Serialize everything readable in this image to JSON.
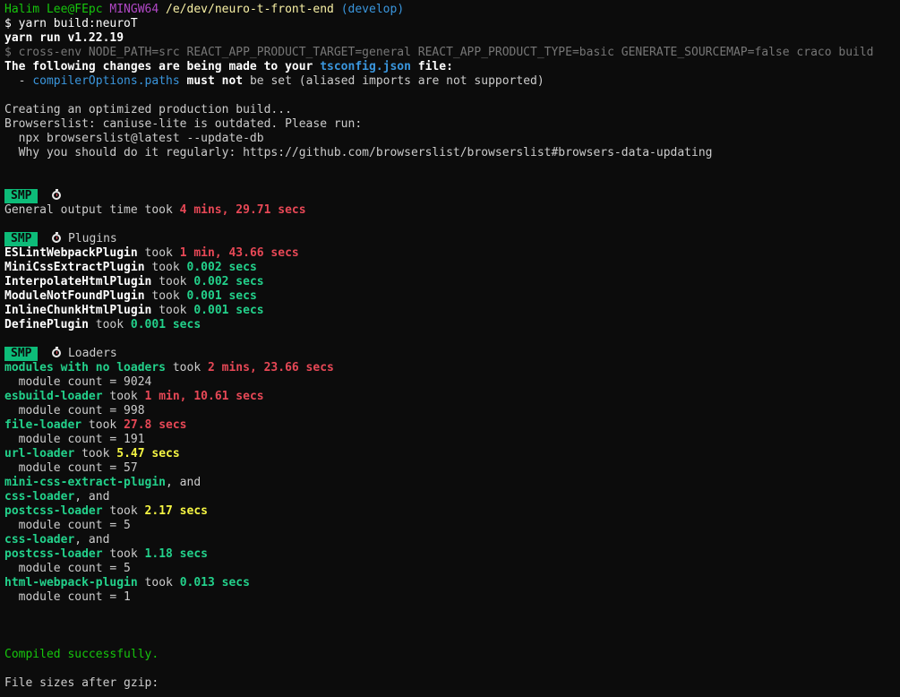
{
  "prompt": {
    "user": "Halim Lee@FEpc",
    "system": "MINGW64",
    "path": "/e/dev/neuro-t-front-end",
    "branch": "(develop)"
  },
  "command": "$ yarn build:neuroT",
  "yarn_version": "yarn run v1.22.19",
  "cross_env_cmd": "$ cross-env NODE_PATH=src REACT_APP_PRODUCT_TARGET=general REACT_APP_PRODUCT_TYPE=basic GENERATE_SOURCEMAP=false craco build",
  "tsconfig": {
    "intro": "The following changes are being made to your ",
    "file": "tsconfig.json",
    "suffix": " file:",
    "dash": "  - ",
    "option": "compilerOptions.paths",
    "must_not": " must not",
    "rest": " be set (aliased imports are not supported)"
  },
  "build_msgs": [
    "Creating an optimized production build...",
    "Browserslist: caniuse-lite is outdated. Please run:",
    "  npx browserslist@latest --update-db",
    "  Why you should do it regularly: https://github.com/browserslist/browserslist#browsers-data-updating"
  ],
  "smp": {
    "badge": "SMP",
    "general_label": "General output time took ",
    "general_time": "4 mins, 29.71 secs",
    "plugins_label": "Plugins",
    "loaders_label": "Loaders"
  },
  "plugins": [
    {
      "name": "ESLintWebpackPlugin",
      "took": " took ",
      "time": "1 min, 43.66 secs",
      "level": "red"
    },
    {
      "name": "MiniCssExtractPlugin",
      "took": " took ",
      "time": "0.002 secs",
      "level": "green"
    },
    {
      "name": "InterpolateHtmlPlugin",
      "took": " took ",
      "time": "0.002 secs",
      "level": "green"
    },
    {
      "name": "ModuleNotFoundPlugin",
      "took": " took ",
      "time": "0.001 secs",
      "level": "green"
    },
    {
      "name": "InlineChunkHtmlPlugin",
      "took": " took ",
      "time": "0.001 secs",
      "level": "green"
    },
    {
      "name": "DefinePlugin",
      "took": " took ",
      "time": "0.001 secs",
      "level": "green"
    }
  ],
  "loaders": {
    "l1": {
      "name": "modules with no loaders",
      "took": " took ",
      "time": "2 mins, 23.66 secs",
      "count": "  module count = 9024"
    },
    "l2": {
      "name": "esbuild-loader",
      "took": " took ",
      "time": "1 min, 10.61 secs",
      "count": "  module count = 998"
    },
    "l3": {
      "name": "file-loader",
      "took": " took ",
      "time": "27.8 secs",
      "count": "  module count = 191"
    },
    "l4": {
      "name": "url-loader",
      "took": " took ",
      "time": "5.47 secs",
      "count": "  module count = 57"
    },
    "l5a": {
      "name": "mini-css-extract-plugin",
      "and": ", and"
    },
    "l5b": {
      "name": "css-loader",
      "and": ", and"
    },
    "l5c": {
      "name": "postcss-loader",
      "took": " took ",
      "time": "2.17 secs",
      "count": "  module count = 5"
    },
    "l6a": {
      "name": "css-loader",
      "and": ", and"
    },
    "l6b": {
      "name": "postcss-loader",
      "took": " took ",
      "time": "1.18 secs",
      "count": "  module count = 5"
    },
    "l7": {
      "name": "html-webpack-plugin",
      "took": " took ",
      "time": "0.013 secs",
      "count": "  module count = 1"
    }
  },
  "compiled": "Compiled successfully.",
  "file_sizes": "File sizes after gzip:",
  "colors": {
    "background": "#0c0c0c",
    "slow": "#e74856",
    "medium": "#f5f543",
    "fast": "#23d18b",
    "badge": "#0dbc79"
  },
  "icons": [
    "stopwatch-icon"
  ]
}
